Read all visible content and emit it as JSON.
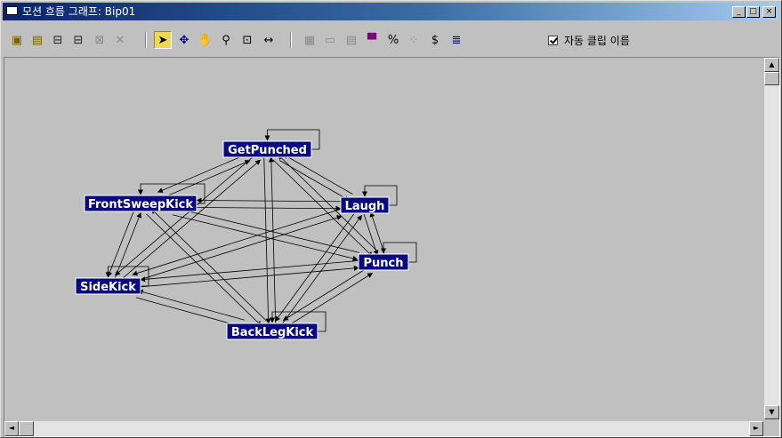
{
  "window": {
    "title": "모션 흐름 그래프: Bip01",
    "controls": {
      "minimize": "_",
      "maximize": "□",
      "close": "×"
    }
  },
  "toolbar": {
    "buttons": [
      {
        "name": "create-clip-icon",
        "glyph": "▣",
        "color": "#806000"
      },
      {
        "name": "open-folder-icon",
        "glyph": "▤",
        "color": "#806000"
      },
      {
        "name": "create-transition-icon",
        "glyph": "⊟",
        "color": "#202020"
      },
      {
        "name": "create-multiple-transitions-icon",
        "glyph": "⊟",
        "color": "#202020"
      },
      {
        "name": "optimize-transitions-icon",
        "glyph": "⊠",
        "color": "#8a8a8a"
      },
      {
        "name": "delete-icon",
        "glyph": "✕",
        "color": "#8a8a8a"
      },
      {
        "name": "select-arrow-icon",
        "glyph": "➤",
        "color": "#000000",
        "active": true
      },
      {
        "name": "move-icon",
        "glyph": "✥",
        "color": "#000080"
      },
      {
        "name": "pan-hand-icon",
        "glyph": "✋",
        "color": "#000000"
      },
      {
        "name": "zoom-icon",
        "glyph": "⚲",
        "color": "#000000"
      },
      {
        "name": "zoom-region-icon",
        "glyph": "⊡",
        "color": "#000000"
      },
      {
        "name": "fit-width-icon",
        "glyph": "↔",
        "color": "#000000"
      },
      {
        "name": "show-random-icon",
        "glyph": "▦",
        "color": "#8a8a8a"
      },
      {
        "name": "remove-script-icon",
        "glyph": "▭",
        "color": "#8a8a8a"
      },
      {
        "name": "properties-icon",
        "glyph": "▤",
        "color": "#8a8a8a"
      },
      {
        "name": "select-start-clip-icon",
        "glyph": "▀",
        "color": "#800080"
      },
      {
        "name": "percent-icon",
        "glyph": "%",
        "color": "#000000"
      },
      {
        "name": "random-weights-icon",
        "glyph": "⁘",
        "color": "#8a8a8a"
      },
      {
        "name": "dollar-icon",
        "glyph": "$",
        "color": "#000000"
      },
      {
        "name": "script-icon",
        "glyph": "≣",
        "color": "#000080"
      }
    ],
    "auto_clip_label": "자동 클립 이름",
    "auto_clip_checked": true
  },
  "graph": {
    "nodes": [
      {
        "id": "GetPunched",
        "label": "GetPunched"
      },
      {
        "id": "Laugh",
        "label": "Laugh"
      },
      {
        "id": "FrontSweepKick",
        "label": "FrontSweepKick"
      },
      {
        "id": "Punch",
        "label": "Punch"
      },
      {
        "id": "SideKick",
        "label": "SideKick"
      },
      {
        "id": "BackLegKick",
        "label": "BackLegKick"
      }
    ],
    "node_bg": "#0a0a80",
    "node_fg": "#ffffff",
    "transitions": "all-to-all including self loops"
  },
  "scroll": {
    "up": "▲",
    "down": "▼",
    "left": "◄",
    "right": "►"
  }
}
